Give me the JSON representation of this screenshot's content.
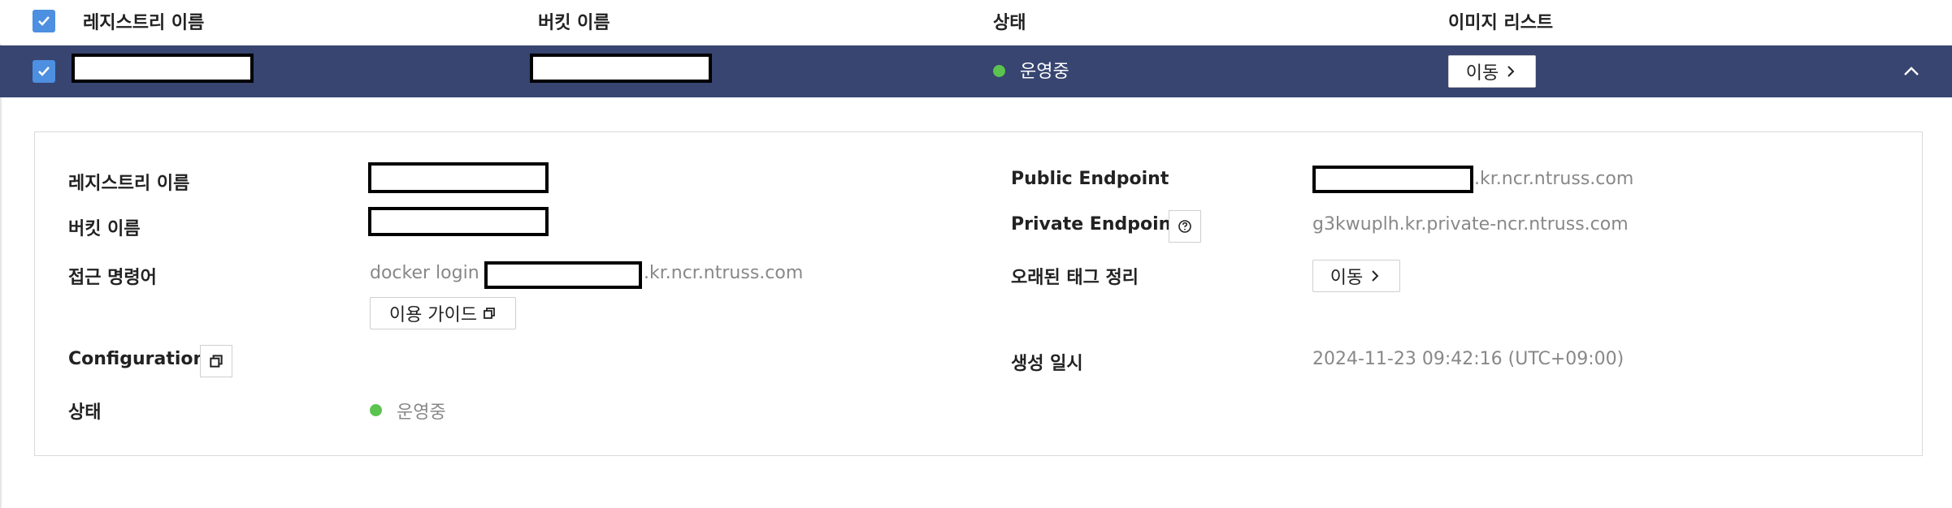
{
  "header": {
    "columns": [
      "레지스트리 이름",
      "버킷 이름",
      "상태",
      "이미지 리스트"
    ]
  },
  "row": {
    "status": "운영중",
    "move_label": "이동"
  },
  "detail": {
    "registry_name_label": "레지스트리 이름",
    "bucket_name_label": "버킷 이름",
    "access_cmd_label": "접근 명령어",
    "access_cmd_prefix": "docker login r",
    "access_cmd_suffix": ".kr.ncr.ntruss.com",
    "usage_guide_label": "이용 가이드",
    "configuration_label": "Configuration",
    "status_label": "상태",
    "status_value": "운영중",
    "public_endpoint_label": "Public Endpoint",
    "public_endpoint_suffix": ".kr.ncr.ntruss.com",
    "private_endpoint_label": "Private Endpoint",
    "private_endpoint_value": "g3kwuplh.kr.private-ncr.ntruss.com",
    "old_tag_cleanup_label": "오래된 태그 정리",
    "old_tag_move_label": "이동",
    "created_at_label": "생성 일시",
    "created_at_value": "2024-11-23 09:42:16 (UTC+09:00)"
  },
  "colors": {
    "selected_row_bg": "#374570",
    "checkbox": "#4d8fe0",
    "status_green": "#5bc34f"
  }
}
